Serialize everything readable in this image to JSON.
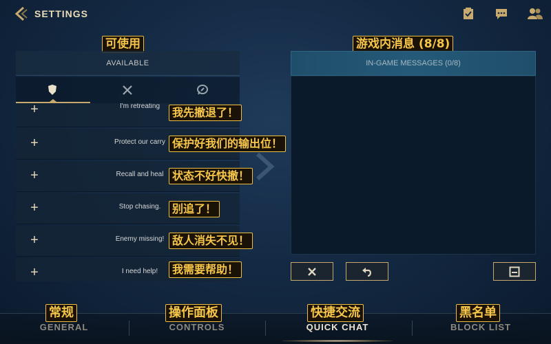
{
  "header": {
    "title": "SETTINGS"
  },
  "available_panel": {
    "cn_label": "可使用",
    "label": "AVAILABLE",
    "items": [
      {
        "text": "I'm retreating",
        "cn": "我先撤退了！"
      },
      {
        "text": "Protect our carry",
        "cn": "保护好我们的输出位！"
      },
      {
        "text": "Recall and heal",
        "cn": "状态不好快撤！"
      },
      {
        "text": "Stop chasing.",
        "cn": "别追了！"
      },
      {
        "text": "Enemy missing!",
        "cn": "敌人消失不见！"
      },
      {
        "text": "I need help!",
        "cn": "我需要帮助！"
      }
    ],
    "plus_glyph": "+"
  },
  "messages_panel": {
    "cn_label": "游戏内消息 (8/8)",
    "label": "IN-GAME MESSAGES (0/8)"
  },
  "nav": [
    {
      "cn": "常规",
      "label": "GENERAL"
    },
    {
      "cn": "操作面板",
      "label": "CONTROLS"
    },
    {
      "cn": "快捷交流",
      "label": "QUICK CHAT"
    },
    {
      "cn": "黑名单",
      "label": "BLOCK LIST"
    }
  ],
  "colors": {
    "gold": "#c8aa6e",
    "annotation_border": "#f0c040",
    "annotation_text": "#f6c64a"
  },
  "icons": {
    "back": "back-chevron-icon",
    "top": [
      "checklist-icon",
      "chat-bubble-icon",
      "friends-icon"
    ],
    "tabs": [
      "shield-icon",
      "crossed-swords-icon",
      "chat-ping-icon"
    ],
    "actions": [
      "close-icon",
      "undo-icon",
      "save-icon"
    ]
  }
}
